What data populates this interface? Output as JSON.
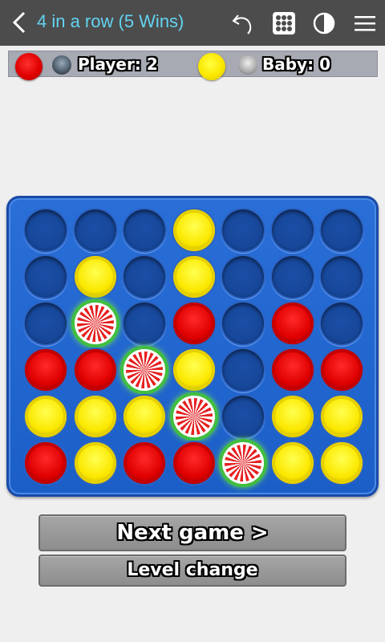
{
  "appbar": {
    "title": "4 in a row (5 Wins)",
    "icons": [
      "back-arrow-icon",
      "undo-icon",
      "grid-icon",
      "contrast-icon",
      "menu-icon"
    ]
  },
  "scores": {
    "player1": {
      "chip_color": "red",
      "label": "Player:",
      "score": "2"
    },
    "player2": {
      "chip_color": "yellow",
      "label": "Baby:",
      "score": "0"
    }
  },
  "board": {
    "columns": 7,
    "rows": 6,
    "cells": [
      [
        "empty",
        "empty",
        "empty",
        "yellow",
        "empty",
        "empty",
        "empty"
      ],
      [
        "empty",
        "yellow",
        "empty",
        "yellow",
        "empty",
        "empty",
        "empty"
      ],
      [
        "empty",
        "win",
        "empty",
        "red",
        "empty",
        "red",
        "empty"
      ],
      [
        "red",
        "red",
        "win",
        "yellow",
        "empty",
        "red",
        "red"
      ],
      [
        "yellow",
        "yellow",
        "yellow",
        "win",
        "empty",
        "yellow",
        "yellow"
      ],
      [
        "red",
        "yellow",
        "red",
        "red",
        "win",
        "yellow",
        "yellow"
      ]
    ]
  },
  "buttons": {
    "next_game": "Next game >",
    "level_change": "Level change"
  },
  "colors": {
    "appbar_bg": "#4c4c4c",
    "title": "#62d3f0",
    "board_blue": "#1b5ec8",
    "red_chip": "#e00000",
    "yellow_chip": "#fbe700",
    "win_glow": "#3fbf3f"
  }
}
